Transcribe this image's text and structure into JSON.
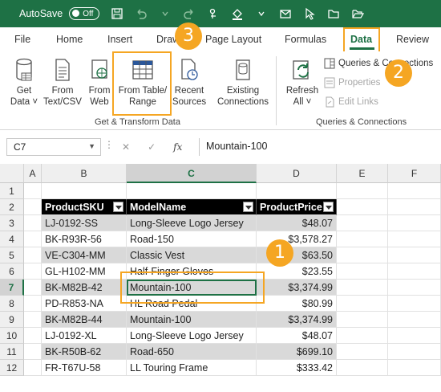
{
  "titlebar": {
    "autosave_label": "AutoSave",
    "toggle_state": "Off"
  },
  "tabs": [
    "File",
    "Home",
    "Insert",
    "Draw",
    "Page Layout",
    "Formulas",
    "Data",
    "Review"
  ],
  "active_tab": "Data",
  "ribbon": {
    "get_transform": {
      "label": "Get & Transform Data",
      "buttons": [
        {
          "line1": "Get",
          "line2": "Data ˅"
        },
        {
          "line1": "From",
          "line2": "Text/CSV"
        },
        {
          "line1": "From",
          "line2": "Web"
        },
        {
          "line1": "From Table/",
          "line2": "Range"
        },
        {
          "line1": "Recent",
          "line2": "Sources"
        },
        {
          "line1": "Existing",
          "line2": "Connections"
        }
      ]
    },
    "queries": {
      "label": "Queries & Connections",
      "refresh": {
        "line1": "Refresh",
        "line2": "All ˅"
      },
      "queries_connections": "Queries & Connections",
      "properties": "Properties",
      "edit_links": "Edit Links"
    }
  },
  "formula_bar": {
    "name_box": "C7",
    "fx": "fx",
    "value": "Mountain-100"
  },
  "grid": {
    "columns": [
      "A",
      "B",
      "C",
      "D",
      "E",
      "F"
    ],
    "selected_column": "C",
    "rows": [
      "1",
      "2",
      "3",
      "4",
      "5",
      "6",
      "7",
      "8",
      "9",
      "10",
      "11",
      "12"
    ],
    "selected_row": "7",
    "table_headers": [
      "ProductSKU",
      "ModelName",
      "ProductPrice"
    ],
    "table_rows": [
      [
        "LJ-0192-SS",
        "Long-Sleeve Logo Jersey",
        "$48.07"
      ],
      [
        "BK-R93R-56",
        "Road-150",
        "$3,578.27"
      ],
      [
        "VE-C304-MM",
        "Classic Vest",
        "$63.50"
      ],
      [
        "GL-H102-MM",
        "Half-Finger Gloves",
        "$23.55"
      ],
      [
        "BK-M82B-42",
        "Mountain-100",
        "$3,374.99"
      ],
      [
        "PD-R853-NA",
        "HL Road Pedal",
        "$80.99"
      ],
      [
        "BK-M82B-44",
        "Mountain-100",
        "$3,374.99"
      ],
      [
        "LJ-0192-XL",
        "Long-Sleeve Logo Jersey",
        "$48.07"
      ],
      [
        "BK-R50B-62",
        "Road-650",
        "$699.10"
      ],
      [
        "FR-T67U-58",
        "LL Touring Frame",
        "$333.42"
      ]
    ]
  },
  "callouts": [
    "1",
    "2",
    "3"
  ],
  "colors": {
    "excel_green": "#1e7145",
    "callout_orange": "#f5a623",
    "band_gray": "#d9d9d9"
  }
}
